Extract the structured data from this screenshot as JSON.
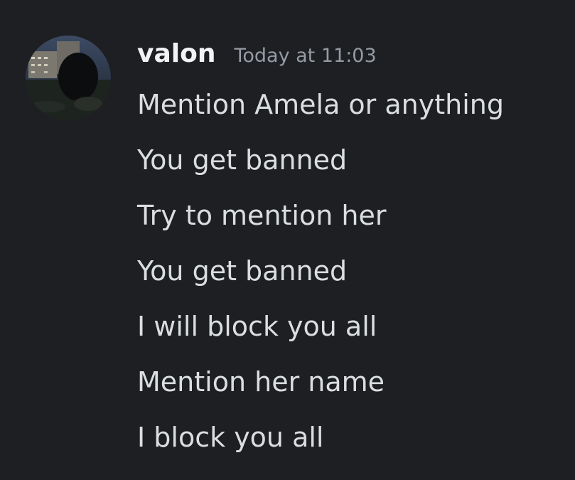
{
  "message": {
    "author": "valon",
    "timestamp": "Today at 11:03",
    "lines": [
      "Mention Amela or anything",
      "You get banned",
      "Try to mention her",
      "You get banned",
      "I will block you all",
      "Mention her name",
      "I block you all"
    ]
  },
  "colors": {
    "background": "#1e1f22",
    "username": "#f2f3f5",
    "timestamp": "#949ba4",
    "text": "#dbdee1"
  },
  "icons": {
    "avatar": "avatar-image"
  }
}
